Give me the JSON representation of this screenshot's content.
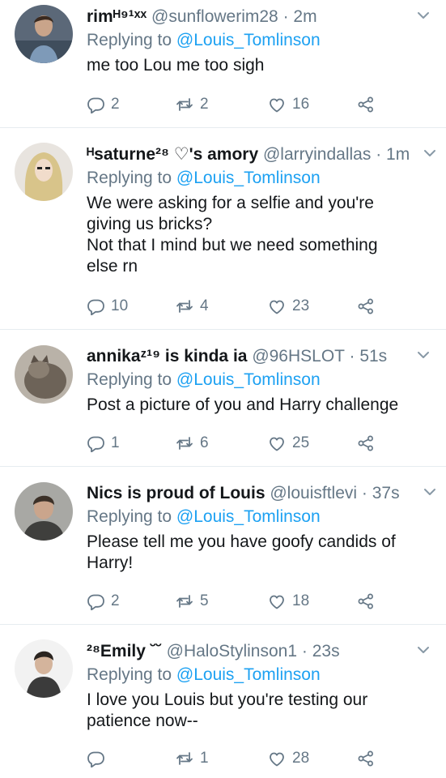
{
  "tweets": [
    {
      "name": "rimᴴ⁹¹ˣˣ",
      "handle": "@sunflowerim28",
      "dot": "·",
      "time": "2m",
      "replying_prefix": "Replying to ",
      "replying_handle": "@Louis_Tomlinson",
      "lines": [
        "me too Lou me too sigh"
      ],
      "replies": "2",
      "retweets": "2",
      "likes": "16"
    },
    {
      "name": "ᴴsaturne²⁸ ♡'s amory",
      "handle": "@larryindallas",
      "dot": "·",
      "time": "1m",
      "replying_prefix": "Replying to ",
      "replying_handle": "@Louis_Tomlinson",
      "lines": [
        "We were asking for a selfie and you're",
        "giving us bricks?",
        "Not that I mind but we need something",
        "else rn"
      ],
      "replies": "10",
      "retweets": "4",
      "likes": "23"
    },
    {
      "name": "annikaᶻ¹⁹ is kinda ia",
      "handle": "@96HSLOT",
      "dot": "·",
      "time": "51s",
      "replying_prefix": "Replying to ",
      "replying_handle": "@Louis_Tomlinson",
      "lines": [
        "Post a picture of you and Harry challenge"
      ],
      "replies": "1",
      "retweets": "6",
      "likes": "25"
    },
    {
      "name": "Nics is proud of Louis",
      "handle": "@louisftlevi",
      "dot": "·",
      "time": "37s",
      "replying_prefix": "Replying to ",
      "replying_handle": "@Louis_Tomlinson",
      "lines": [
        "Please tell me you have goofy candids of",
        "Harry!"
      ],
      "replies": "2",
      "retweets": "5",
      "likes": "18"
    },
    {
      "name": "²⁸Emily ˘˘",
      "handle": "@HaloStylinson1",
      "dot": "·",
      "time": "23s",
      "replying_prefix": "Replying to ",
      "replying_handle": "@Louis_Tomlinson",
      "lines": [
        "I love you Louis but you're testing our",
        "patience now--"
      ],
      "replies": "",
      "retweets": "1",
      "likes": "28"
    }
  ],
  "colors": {
    "text": "#14171a",
    "muted": "#657786",
    "link": "#1da1f2",
    "divider": "#e6ecf0"
  },
  "icons": [
    "reply-icon",
    "retweet-icon",
    "like-icon",
    "share-icon",
    "chevron-down-icon"
  ]
}
